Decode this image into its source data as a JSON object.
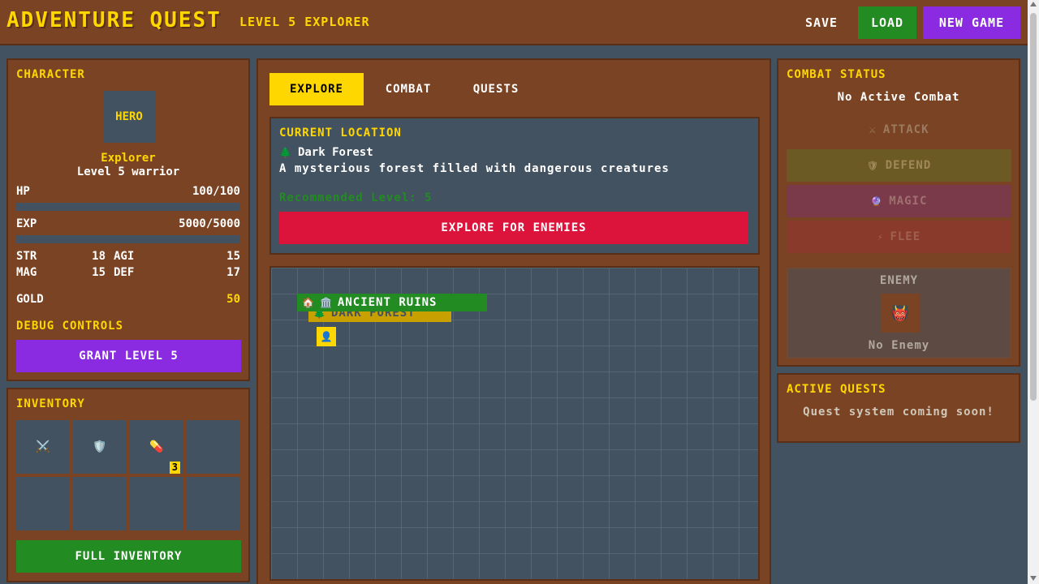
{
  "header": {
    "title": "ADVENTURE QUEST",
    "subtitle": "LEVEL 5 EXPLORER",
    "save_label": "SAVE",
    "load_label": "LOAD",
    "new_game_label": "NEW GAME"
  },
  "character": {
    "panel_title": "CHARACTER",
    "avatar_label": "HERO",
    "class_name": "Explorer",
    "level_text": "Level 5 warrior",
    "hp_label": "HP",
    "hp_value": "100/100",
    "hp_fraction": 1.0,
    "exp_label": "EXP",
    "exp_value": "5000/5000",
    "exp_fraction": 1.0,
    "str_label": "STR",
    "str_value": "18",
    "agi_label": "AGI",
    "agi_value": "15",
    "mag_label": "MAG",
    "mag_value": "15",
    "def_label": "DEF",
    "def_value": "17",
    "gold_label": "GOLD",
    "gold_value": "50",
    "debug_title": "DEBUG CONTROLS",
    "grant_label": "GRANT LEVEL 5"
  },
  "inventory": {
    "panel_title": "INVENTORY",
    "slots": [
      {
        "icon": "⚔️",
        "icon_name": "sword-icon",
        "count": ""
      },
      {
        "icon": "🛡️",
        "icon_name": "shield-icon",
        "count": ""
      },
      {
        "icon": "💊",
        "icon_name": "potion-icon",
        "count": "3"
      },
      {
        "icon": "",
        "icon_name": "",
        "count": ""
      },
      {
        "icon": "",
        "icon_name": "",
        "count": ""
      },
      {
        "icon": "",
        "icon_name": "",
        "count": ""
      },
      {
        "icon": "",
        "icon_name": "",
        "count": ""
      },
      {
        "icon": "",
        "icon_name": "",
        "count": ""
      }
    ],
    "full_label": "FULL INVENTORY"
  },
  "main": {
    "tabs": [
      {
        "label": "EXPLORE",
        "active": true
      },
      {
        "label": "COMBAT",
        "active": false
      },
      {
        "label": "QUESTS",
        "active": false
      }
    ],
    "location": {
      "title": "CURRENT LOCATION",
      "icon": "🌲",
      "name": "Dark Forest",
      "description": "A mysterious forest filled with dangerous creatures",
      "recommended": "Recommended Level: 5",
      "explore_label": "EXPLORE FOR ENEMIES"
    },
    "map": {
      "forest_icon": "🌲",
      "forest_label": "DARK FOREST",
      "ruins_icon1": "🏠",
      "ruins_icon2": "🏛️",
      "ruins_label": "ANCIENT RUINS",
      "player_icon": "👤"
    }
  },
  "combat": {
    "panel_title": "COMBAT STATUS",
    "status": "No Active Combat",
    "attack_icon": "⚔",
    "attack_label": "ATTACK",
    "defend_icon": "🛡",
    "defend_label": "DEFEND",
    "magic_icon": "🔮",
    "magic_label": "MAGIC",
    "flee_icon": "⚡",
    "flee_label": "FLEE",
    "enemy_title": "ENEMY",
    "enemy_icon": "👹",
    "enemy_name": "No Enemy"
  },
  "quests": {
    "panel_title": "ACTIVE QUESTS",
    "message": "Quest system coming soon!"
  },
  "colors": {
    "panel": "#7a4424",
    "background": "#435260",
    "gold": "#ffd700",
    "green": "#228b22",
    "purple": "#8a2be2",
    "red": "#dc143c"
  }
}
